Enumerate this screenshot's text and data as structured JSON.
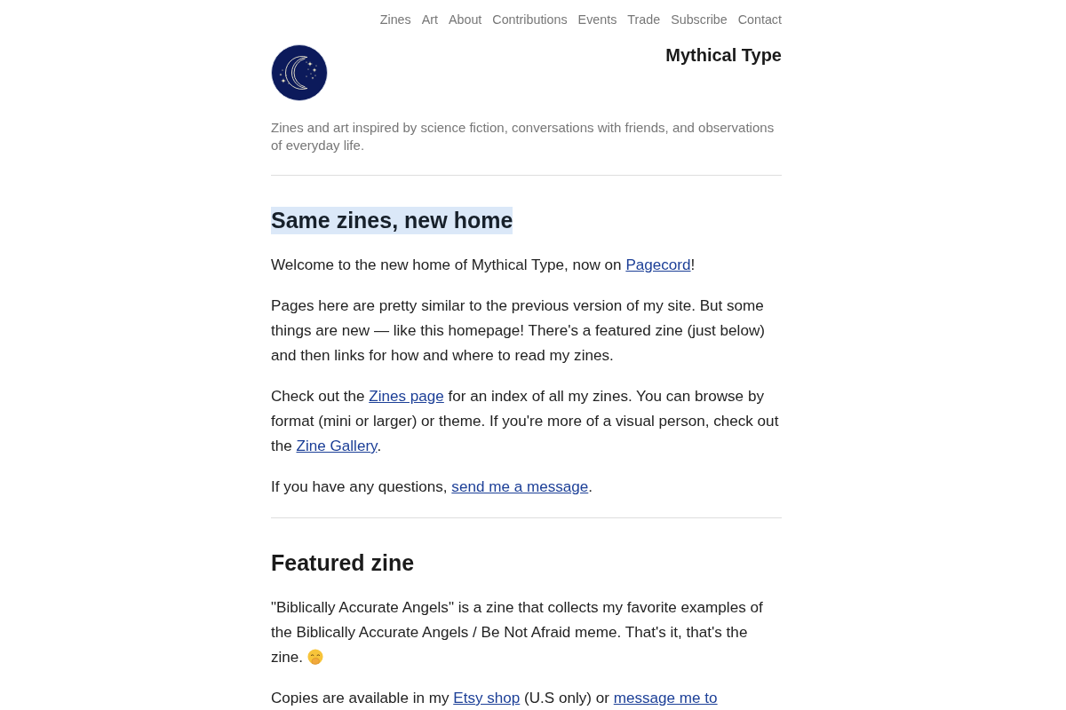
{
  "nav": {
    "links": [
      "Zines",
      "Art",
      "About",
      "Contributions",
      "Events",
      "Trade",
      "Subscribe",
      "Contact"
    ]
  },
  "header": {
    "site_title": "Mythical Type",
    "tagline": "Zines and art inspired by science fiction, conversations with friends, and observations of everyday life."
  },
  "sections": [
    {
      "heading": "Same zines, new home",
      "highlighted": true,
      "paragraphs": [
        [
          {
            "kind": "text",
            "text": "Welcome to the new home of Mythical Type, now on "
          },
          {
            "kind": "link",
            "text": "Pagecord"
          },
          {
            "kind": "text",
            "text": "!"
          }
        ],
        [
          {
            "kind": "text",
            "text": "Pages here are pretty similar to the previous version of my site. But some things are new — like this homepage! There's a featured zine (just below) and then links for how and where to read my zines."
          }
        ],
        [
          {
            "kind": "text",
            "text": "Check out the "
          },
          {
            "kind": "link",
            "text": "Zines page"
          },
          {
            "kind": "text",
            "text": " for an index of all my zines. You can browse by format (mini or larger) or theme. If you're more of a visual person, check out the "
          },
          {
            "kind": "link",
            "text": "Zine Gallery"
          },
          {
            "kind": "text",
            "text": "."
          }
        ],
        [
          {
            "kind": "text",
            "text": "If you have any questions, "
          },
          {
            "kind": "link",
            "text": "send me a message"
          },
          {
            "kind": "text",
            "text": "."
          }
        ]
      ]
    },
    {
      "heading": "Featured zine",
      "highlighted": false,
      "paragraphs": [
        [
          {
            "kind": "text",
            "text": "\"Biblically Accurate Angels\" is a zine that collects my favorite examples of the Biblically Accurate Angels / Be Not Afraid meme. That's it, that's the zine. "
          },
          {
            "kind": "icon"
          }
        ],
        [
          {
            "kind": "text",
            "text": "Copies are available in my "
          },
          {
            "kind": "link",
            "text": "Etsy shop"
          },
          {
            "kind": "text",
            "text": " (U.S only) or "
          },
          {
            "kind": "link",
            "text": "message me to"
          }
        ]
      ]
    }
  ]
}
